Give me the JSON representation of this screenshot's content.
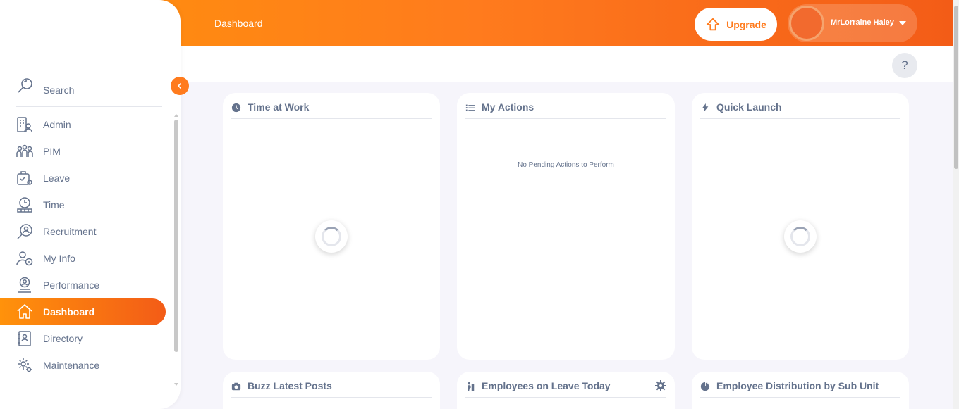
{
  "topbar": {
    "title": "Dashboard",
    "upgrade_label": "Upgrade",
    "user_name": "MrLorraine Haley",
    "accent_color": "#ff7b1d"
  },
  "help": {
    "label": "?"
  },
  "sidebar": {
    "search_label": "Search",
    "collapse_icon": "chevron-left-icon",
    "items": [
      {
        "label": "Admin",
        "icon": "admin-icon",
        "active": false
      },
      {
        "label": "PIM",
        "icon": "pim-icon",
        "active": false
      },
      {
        "label": "Leave",
        "icon": "leave-icon",
        "active": false
      },
      {
        "label": "Time",
        "icon": "time-icon",
        "active": false
      },
      {
        "label": "Recruitment",
        "icon": "recruitment-icon",
        "active": false
      },
      {
        "label": "My Info",
        "icon": "my-info-icon",
        "active": false
      },
      {
        "label": "Performance",
        "icon": "performance-icon",
        "active": false
      },
      {
        "label": "Dashboard",
        "icon": "home-icon",
        "active": true
      },
      {
        "label": "Directory",
        "icon": "directory-icon",
        "active": false
      },
      {
        "label": "Maintenance",
        "icon": "maintenance-icon",
        "active": false
      }
    ]
  },
  "widgets": {
    "time_at_work": {
      "title": "Time at Work",
      "icon": "clock-icon"
    },
    "my_actions": {
      "title": "My Actions",
      "icon": "list-icon",
      "empty_message": "No Pending Actions to Perform"
    },
    "quick_launch": {
      "title": "Quick Launch",
      "icon": "bolt-icon"
    },
    "buzz": {
      "title": "Buzz Latest Posts",
      "icon": "camera-icon"
    },
    "leave_today": {
      "title": "Employees on Leave Today",
      "icon": "leave-person-icon"
    },
    "distribution": {
      "title": "Employee Distribution by Sub Unit",
      "icon": "pie-icon"
    }
  }
}
